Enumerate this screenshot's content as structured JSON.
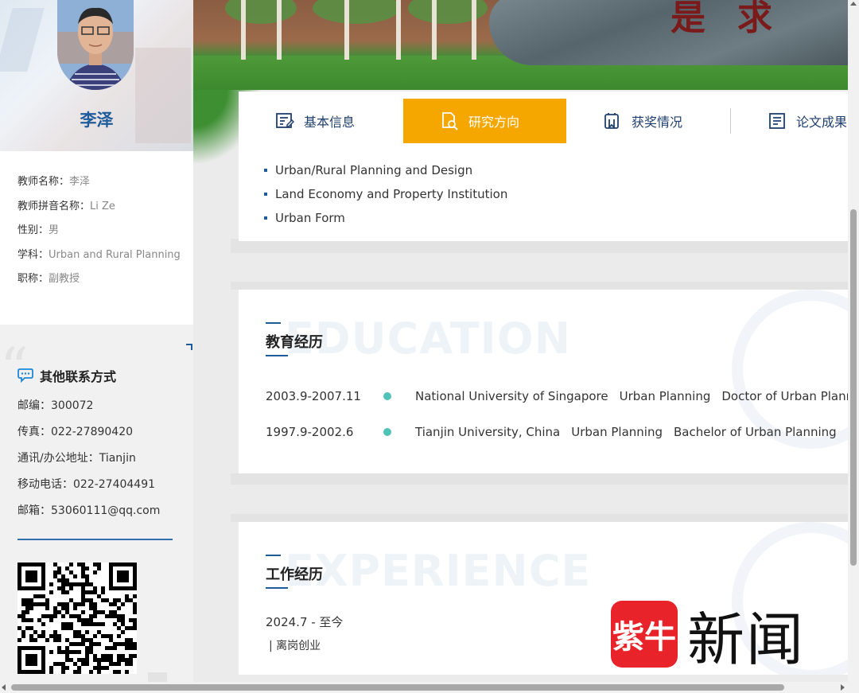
{
  "profile": {
    "name": "李泽",
    "info": [
      {
        "key": "教师名称：",
        "value": "李泽"
      },
      {
        "key": "教师拼音名称：",
        "value": "Li Ze"
      },
      {
        "key": "性别：",
        "value": "男"
      },
      {
        "key": "学科：",
        "value": "Urban and Rural Planning"
      },
      {
        "key": "职称：",
        "value": "副教授"
      }
    ]
  },
  "contact": {
    "title": "其他联系方式",
    "rows": [
      "邮编：300072",
      "传真：022-27890420",
      "通讯/办公地址：Tianjin",
      "移动电话：022-27404491",
      "邮箱：53060111@qq.com"
    ]
  },
  "banner": {
    "stone_text": "是求"
  },
  "tabs": [
    {
      "label": "基本信息",
      "icon": "profile-form-icon"
    },
    {
      "label": "研究方向",
      "icon": "research-search-icon",
      "active": true
    },
    {
      "label": "获奖情况",
      "icon": "award-certificate-icon"
    },
    {
      "label": "论文成果",
      "icon": "paper-list-icon"
    }
  ],
  "research": [
    "Urban/Rural Planning and Design",
    "Land Economy and Property Institution",
    "Urban Form"
  ],
  "education": {
    "title": "教育经历",
    "bg_word": "EDUCATION",
    "rows": [
      {
        "date": "2003.9-2007.11",
        "school": "National University of Singapore",
        "major": "Urban Planning",
        "degree": "Doctor of Urban Planning"
      },
      {
        "date": "1997.9-2002.6",
        "school": "Tianjin University, China",
        "major": "Urban Planning",
        "degree": "Bachelor of Urban Planning"
      }
    ]
  },
  "experience": {
    "title": "工作经历",
    "bg_word": "EXPERIENCE",
    "date": "2024.7 - 至今",
    "desc": "| 离岗创业"
  },
  "watermark": {
    "badge": "紫牛",
    "word": "新闻"
  },
  "colors": {
    "accent_blue": "#1e5b9a",
    "tab_active": "#f5a700",
    "timeline_dot": "#4fc3b5"
  }
}
